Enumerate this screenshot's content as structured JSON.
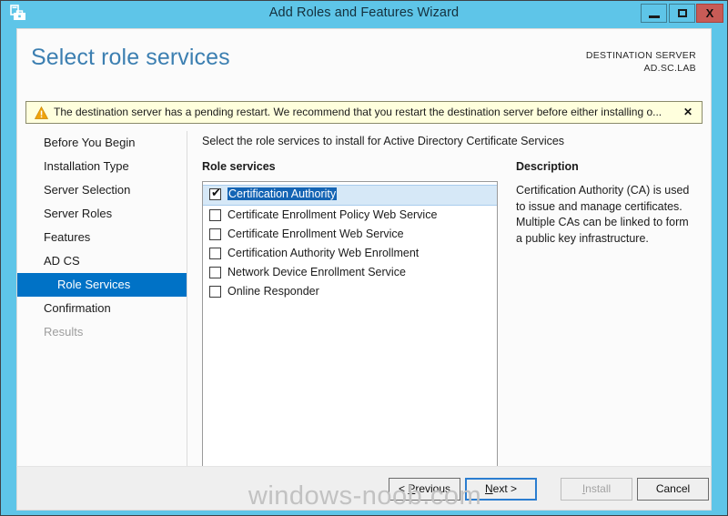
{
  "window": {
    "title": "Add Roles and Features Wizard",
    "icon": "server-roles-icon",
    "minimize_label": "–",
    "maximize_label": "□",
    "close_label": "X",
    "titlebar_color": "#5ec5e8"
  },
  "header": {
    "page_title": "Select role services",
    "destination_label": "DESTINATION SERVER",
    "destination_value": "AD.SC.LAB",
    "title_color": "#3c7fb1"
  },
  "warning": {
    "icon": "warning-triangle-icon",
    "text": "The destination server has a pending restart. We recommend that you restart the destination server before either installing o...",
    "close_label": "✕",
    "background_color": "#ffffdd",
    "icon_color": "#f0a30a"
  },
  "sidebar": {
    "selected_color": "#0072c6",
    "items": [
      {
        "label": "Before You Begin",
        "state": "normal",
        "sub": false
      },
      {
        "label": "Installation Type",
        "state": "normal",
        "sub": false
      },
      {
        "label": "Server Selection",
        "state": "normal",
        "sub": false
      },
      {
        "label": "Server Roles",
        "state": "normal",
        "sub": false
      },
      {
        "label": "Features",
        "state": "normal",
        "sub": false
      },
      {
        "label": "AD CS",
        "state": "normal",
        "sub": false
      },
      {
        "label": "Role Services",
        "state": "selected",
        "sub": true
      },
      {
        "label": "Confirmation",
        "state": "normal",
        "sub": false
      },
      {
        "label": "Results",
        "state": "disabled",
        "sub": false
      }
    ]
  },
  "main": {
    "instruction": "Select the role services to install for Active Directory Certificate Services",
    "role_services_label": "Role services",
    "role_services": [
      {
        "label": "Certification Authority",
        "checked": true,
        "selected": true
      },
      {
        "label": "Certificate Enrollment Policy Web Service",
        "checked": false,
        "selected": false
      },
      {
        "label": "Certificate Enrollment Web Service",
        "checked": false,
        "selected": false
      },
      {
        "label": "Certification Authority Web Enrollment",
        "checked": false,
        "selected": false
      },
      {
        "label": "Network Device Enrollment Service",
        "checked": false,
        "selected": false
      },
      {
        "label": "Online Responder",
        "checked": false,
        "selected": false
      }
    ],
    "checkbox_tick": "✔",
    "description_title": "Description",
    "description_body": "Certification Authority (CA) is used to issue and manage certificates. Multiple CAs can be linked to form a public key infrastructure."
  },
  "footer": {
    "buttons": [
      {
        "id": "previous",
        "prefix": "< ",
        "mnemonic": "P",
        "suffix": "revious",
        "state": "normal"
      },
      {
        "id": "next",
        "prefix": "",
        "mnemonic": "N",
        "suffix": "ext >",
        "state": "focused"
      },
      {
        "id": "install",
        "prefix": "",
        "mnemonic": "I",
        "suffix": "nstall",
        "state": "disabled"
      },
      {
        "id": "cancel",
        "prefix": "",
        "mnemonic": "",
        "suffix": "Cancel",
        "state": "normal"
      }
    ]
  },
  "watermark": {
    "text": "windows-noob.com"
  }
}
